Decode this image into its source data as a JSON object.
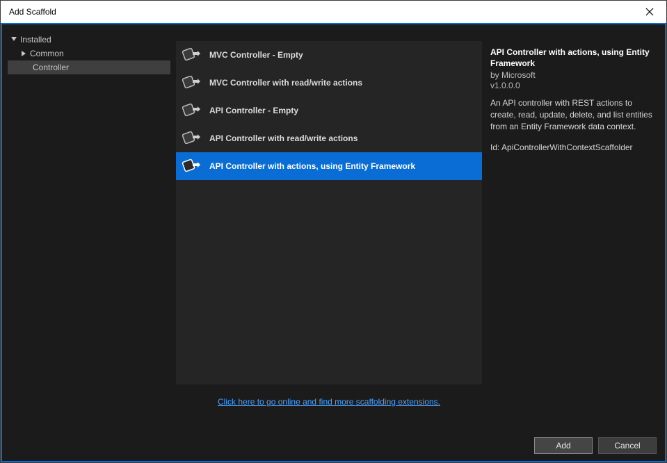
{
  "window": {
    "title": "Add Scaffold"
  },
  "sidebar": {
    "root": "Installed",
    "items": [
      {
        "label": "Common",
        "expandable": true
      },
      {
        "label": "Controller",
        "expandable": false,
        "selected": true
      }
    ]
  },
  "list": {
    "items": [
      {
        "label": "MVC Controller - Empty"
      },
      {
        "label": "MVC Controller with read/write actions"
      },
      {
        "label": "API Controller - Empty"
      },
      {
        "label": "API Controller with read/write actions"
      },
      {
        "label": "API Controller with actions, using Entity Framework",
        "selected": true
      }
    ]
  },
  "link": {
    "text": "Click here to go online and find more scaffolding extensions."
  },
  "details": {
    "title": "API Controller with actions, using Entity Framework",
    "author": "by Microsoft",
    "version": "v1.0.0.0",
    "description": "An API controller with REST actions to create, read, update, delete, and list entities from an Entity Framework data context.",
    "id": "Id: ApiControllerWithContextScaffolder"
  },
  "footer": {
    "add": "Add",
    "cancel": "Cancel"
  }
}
